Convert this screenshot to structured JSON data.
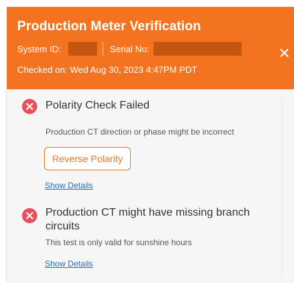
{
  "header": {
    "title": "Production Meter Verification",
    "system_id_label": "System ID:",
    "serial_no_label": "Serial No:",
    "checked_on": "Checked on: Wed Aug 30, 2023 4:47PM PDT",
    "close_icon": "close-icon"
  },
  "colors": {
    "brand_orange": "#f37321",
    "error_red": "#e8505b",
    "link_blue": "#1f6fbf"
  },
  "issues": [
    {
      "icon": "error-x-circle-icon",
      "title": "Polarity Check Failed",
      "description": "Production CT direction or phase might be incorrect",
      "action_label": "Reverse Polarity",
      "details_label": "Show Details"
    },
    {
      "icon": "error-x-circle-icon",
      "title": "Production CT might have missing branch circuits",
      "description": "This test is only valid for sunshine hours",
      "details_label": "Show Details"
    }
  ]
}
